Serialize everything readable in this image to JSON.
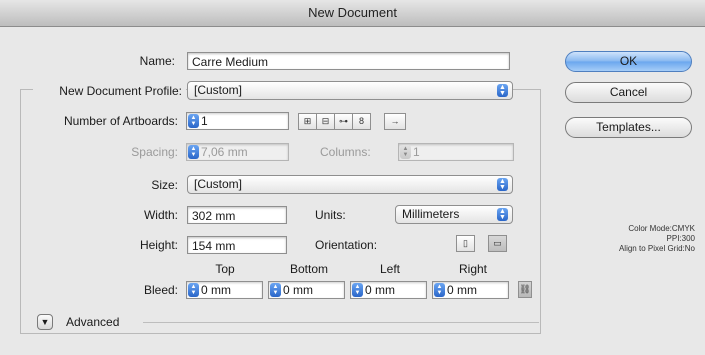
{
  "window": {
    "title": "New Document"
  },
  "name": {
    "label": "Name:",
    "value": "Carre Medium"
  },
  "profile": {
    "label": "New Document Profile:",
    "value": "[Custom]"
  },
  "artboards": {
    "label": "Number of Artboards:",
    "value": "1"
  },
  "spacing": {
    "label": "Spacing:",
    "value": "7,06 mm"
  },
  "columns": {
    "label": "Columns:",
    "value": "1"
  },
  "size": {
    "label": "Size:",
    "value": "[Custom]"
  },
  "width": {
    "label": "Width:",
    "value": "302 mm"
  },
  "height": {
    "label": "Height:",
    "value": "154 mm"
  },
  "units": {
    "label": "Units:",
    "value": "Millimeters"
  },
  "orientation": {
    "label": "Orientation:"
  },
  "bleed": {
    "label": "Bleed:",
    "columns": [
      "Top",
      "Bottom",
      "Left",
      "Right"
    ],
    "values": [
      "0 mm",
      "0 mm",
      "0 mm",
      "0 mm"
    ]
  },
  "advanced": {
    "label": "Advanced"
  },
  "buttons": {
    "ok": "OK",
    "cancel": "Cancel",
    "templates": "Templates..."
  },
  "doc_info": {
    "color_mode": "Color Mode:CMYK",
    "ppi": "PPI:300",
    "align": "Align to Pixel Grid:No"
  },
  "colors": {
    "accent": "#2a66c8",
    "ok_button": "#86b7f0"
  },
  "icons": [
    "grid-by-row-icon",
    "grid-by-column-icon",
    "arrange-by-row-icon",
    "arrange-by-column-icon",
    "right-to-left-layout-icon",
    "portrait-icon",
    "landscape-icon",
    "link-icon",
    "stepper-icon",
    "popup-arrows-icon",
    "disclosure-triangle-icon"
  ]
}
